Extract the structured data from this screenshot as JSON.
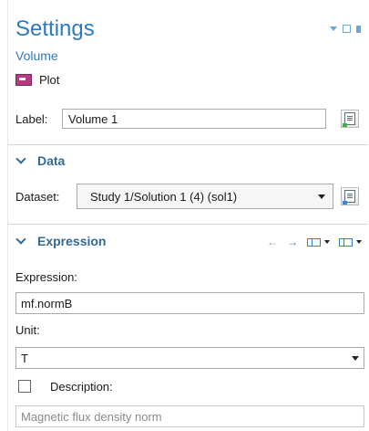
{
  "header": {
    "title": "Settings",
    "subtitle": "Volume",
    "node_type": "Plot",
    "window_controls": [
      "menu-icon",
      "maximize-icon",
      "pin-icon"
    ]
  },
  "label_row": {
    "label": "Label:",
    "value": "Volume 1"
  },
  "data_section": {
    "title": "Data",
    "dataset_label": "Dataset:",
    "dataset_value": "Study 1/Solution 1 (4) (sol1)"
  },
  "expression_section": {
    "title": "Expression",
    "expression_label": "Expression:",
    "expression_value": "mf.normB",
    "unit_label": "Unit:",
    "unit_value": "T",
    "description_label": "Description:",
    "description_checked": false,
    "description_value": "Magnetic flux density norm"
  },
  "colors": {
    "accent": "#3079bf",
    "section_header": "#2f6a98"
  }
}
